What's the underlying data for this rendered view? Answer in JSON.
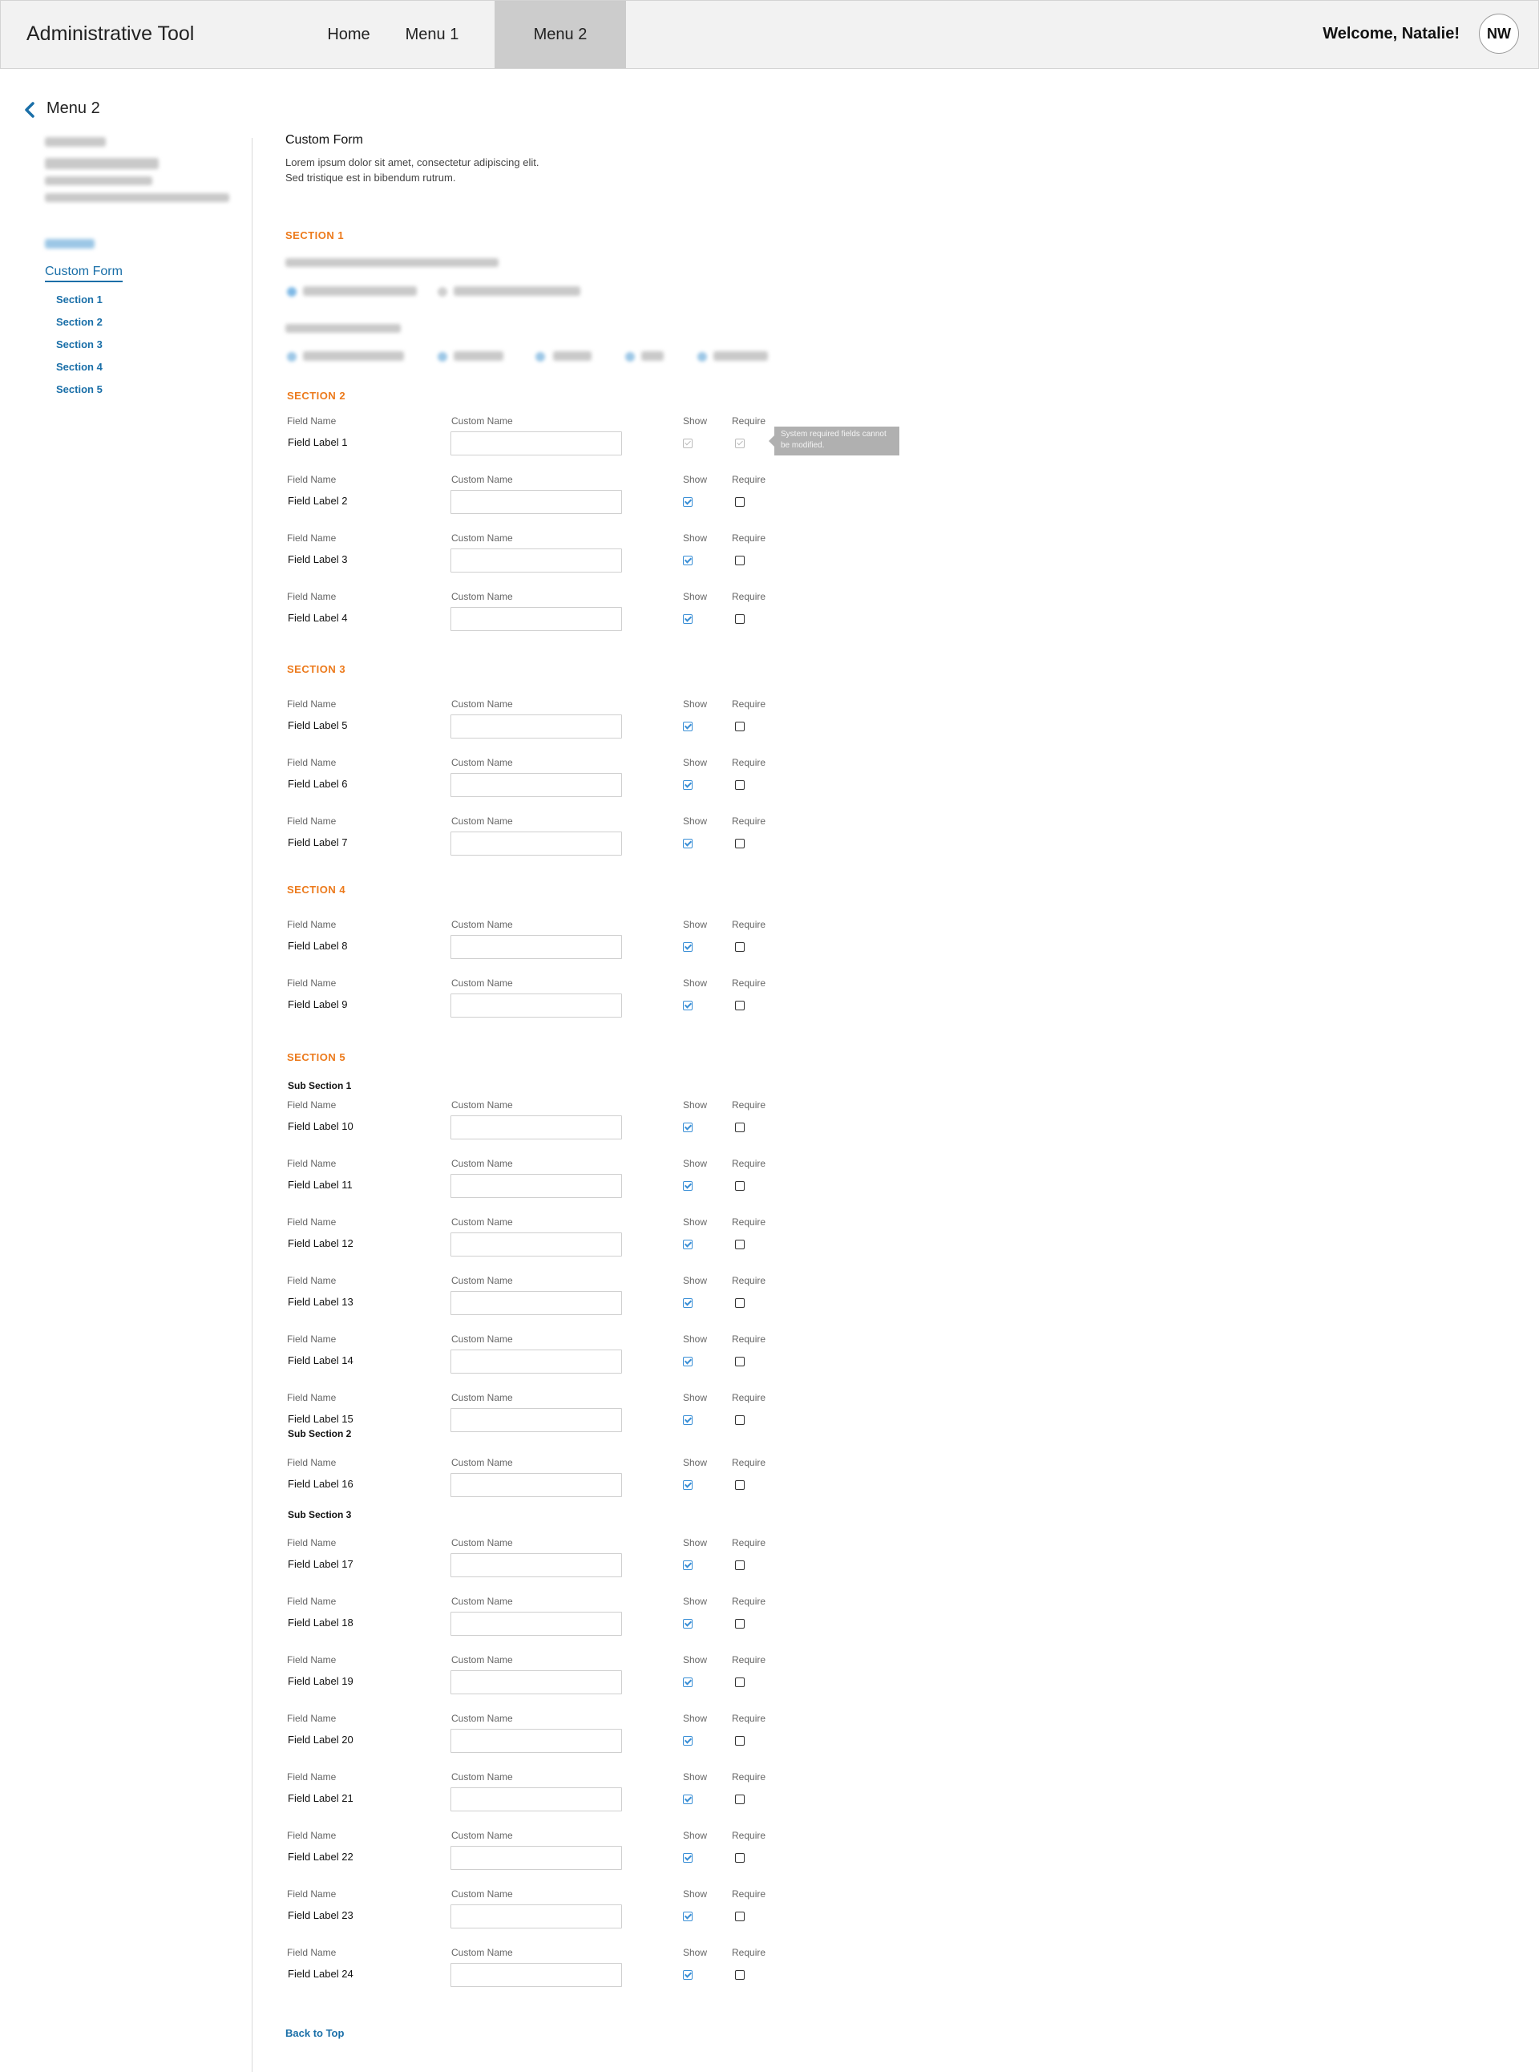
{
  "header": {
    "app_title": "Administrative Tool",
    "nav": [
      {
        "label": "Home",
        "active": false
      },
      {
        "label": "Menu 1",
        "active": false
      },
      {
        "label": "Menu 2",
        "active": true
      }
    ],
    "welcome": "Welcome, Natalie!",
    "avatar_initials": "NW"
  },
  "breadcrumb": {
    "back_label": "Menu 2"
  },
  "sidebar": {
    "active_item": "Custom Form",
    "sections": [
      "Section 1",
      "Section 2",
      "Section 3",
      "Section 4",
      "Section 5"
    ]
  },
  "form": {
    "title": "Custom Form",
    "description_line1": "Lorem ipsum dolor sit amet, consectetur adipiscing elit.",
    "description_line2": "Sed tristique est in bibendum rutrum."
  },
  "labels": {
    "field_name": "Field Name",
    "custom_name": "Custom Name",
    "show": "Show",
    "require": "Require"
  },
  "section1": {
    "header": "SECTION 1"
  },
  "sections": [
    {
      "header": "SECTION 2",
      "groups": [
        {
          "title": "",
          "rows": [
            {
              "label": "Field Label 1",
              "show": true,
              "require": true,
              "locked": true
            },
            {
              "label": "Field Label 2",
              "show": true,
              "require": false
            },
            {
              "label": "Field Label 3",
              "show": true,
              "require": false
            },
            {
              "label": "Field Label 4",
              "show": true,
              "require": false
            }
          ]
        }
      ]
    },
    {
      "header": "SECTION 3",
      "groups": [
        {
          "title": "",
          "rows": [
            {
              "label": "Field Label 5",
              "show": true,
              "require": false
            },
            {
              "label": "Field Label 6",
              "show": true,
              "require": false
            },
            {
              "label": "Field Label 7",
              "show": true,
              "require": false
            }
          ]
        }
      ]
    },
    {
      "header": "SECTION 4",
      "groups": [
        {
          "title": "",
          "rows": [
            {
              "label": "Field Label 8",
              "show": true,
              "require": false
            },
            {
              "label": "Field Label 9",
              "show": true,
              "require": false
            }
          ]
        }
      ]
    },
    {
      "header": "SECTION 5",
      "groups": [
        {
          "title": "Sub Section 1",
          "rows": [
            {
              "label": "Field Label 10",
              "show": true,
              "require": false
            },
            {
              "label": "Field Label 11",
              "show": true,
              "require": false
            },
            {
              "label": "Field Label 12",
              "show": true,
              "require": false
            },
            {
              "label": "Field Label 13",
              "show": true,
              "require": false
            },
            {
              "label": "Field Label 14",
              "show": true,
              "require": false
            },
            {
              "label": "Field Label 15",
              "show": true,
              "require": false
            }
          ]
        },
        {
          "title": "Sub Section 2",
          "rows": [
            {
              "label": "Field Label 16",
              "show": true,
              "require": false
            }
          ]
        },
        {
          "title": "Sub Section 3",
          "rows": [
            {
              "label": "Field Label 17",
              "show": true,
              "require": false
            },
            {
              "label": "Field Label 18",
              "show": true,
              "require": false
            },
            {
              "label": "Field Label 19",
              "show": true,
              "require": false
            },
            {
              "label": "Field Label 20",
              "show": true,
              "require": false
            },
            {
              "label": "Field Label 21",
              "show": true,
              "require": false
            },
            {
              "label": "Field Label 22",
              "show": true,
              "require": false
            },
            {
              "label": "Field Label 23",
              "show": true,
              "require": false
            },
            {
              "label": "Field Label 24",
              "show": true,
              "require": false
            }
          ]
        }
      ]
    }
  ],
  "tooltip": {
    "text": "System required fields cannot be modified."
  },
  "back_to_top": "Back to Top",
  "colors": {
    "accent": "#1a6fa8",
    "section": "#ec7a1c",
    "check": "#3a8fd6"
  }
}
